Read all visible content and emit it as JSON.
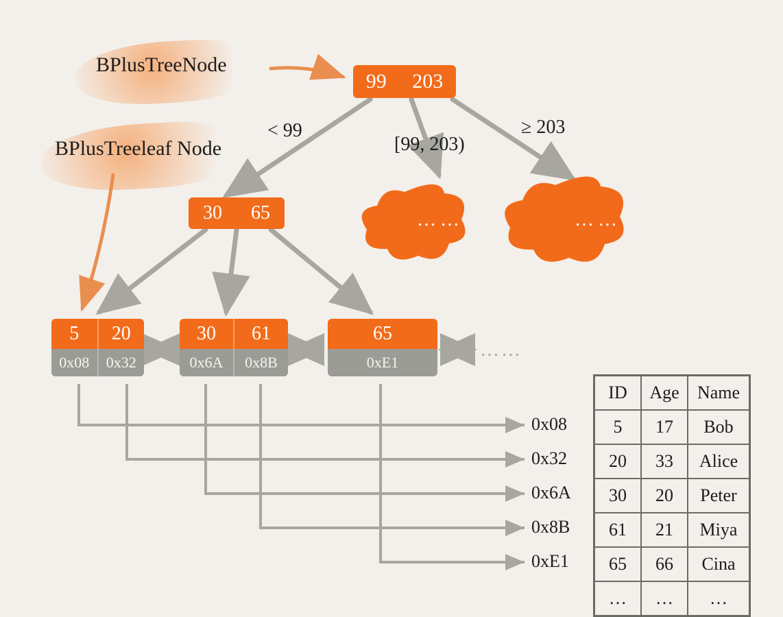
{
  "labels": {
    "internal": "BPlusTreeNode",
    "leaf": "BPlusTreeleaf Node"
  },
  "root": {
    "keys": [
      "99",
      "203"
    ]
  },
  "edge_labels": {
    "left": "< 99",
    "mid": "[99, 203)",
    "right": "≥ 203"
  },
  "internal2": {
    "keys": [
      "30",
      "65"
    ]
  },
  "leaves": [
    {
      "keys": [
        "5",
        "20"
      ],
      "addrs": [
        "0x08",
        "0x32"
      ]
    },
    {
      "keys": [
        "30",
        "61"
      ],
      "addrs": [
        "0x6A",
        "0x8B"
      ]
    },
    {
      "keys": [
        "65"
      ],
      "addrs": [
        "0xE1"
      ]
    }
  ],
  "subtrees": {
    "dots": "……"
  },
  "trailing_dots": "……",
  "row_addrs": [
    "0x08",
    "0x32",
    "0x6A",
    "0x8B",
    "0xE1"
  ],
  "table": {
    "headers": [
      "ID",
      "Age",
      "Name"
    ],
    "rows": [
      [
        "5",
        "17",
        "Bob"
      ],
      [
        "20",
        "33",
        "Alice"
      ],
      [
        "30",
        "20",
        "Peter"
      ],
      [
        "61",
        "21",
        "Miya"
      ],
      [
        "65",
        "66",
        "Cina"
      ],
      [
        "…",
        "…",
        "…"
      ]
    ]
  }
}
